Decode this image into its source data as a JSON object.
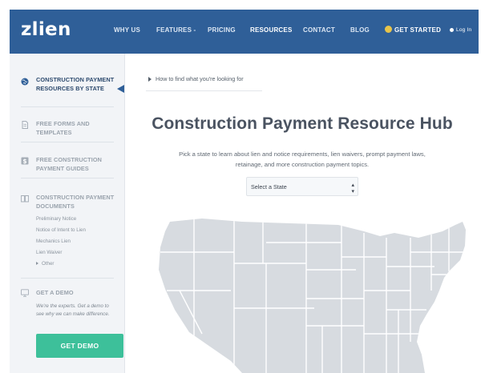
{
  "header": {
    "logo": "zlien",
    "nav": [
      {
        "label": "WHY US"
      },
      {
        "label": "FEATURES -"
      },
      {
        "label": "PRICING"
      },
      {
        "label": "RESOURCES"
      },
      {
        "label": "CONTACT"
      },
      {
        "label": "BLOG"
      },
      {
        "label": "GET STARTED"
      },
      {
        "label": "Log In"
      }
    ]
  },
  "sidebar": {
    "sections": [
      {
        "title": "CONSTRUCTION PAYMENT RESOURCES BY STATE"
      },
      {
        "title": "FREE FORMS AND TEMPLATES"
      },
      {
        "title": "FREE CONSTRUCTION PAYMENT GUIDES"
      },
      {
        "title": "CONSTRUCTION PAYMENT DOCUMENTS"
      },
      {
        "title": "GET A DEMO"
      }
    ],
    "documents": [
      "Preliminary Notice",
      "Notice of Intent to Lien",
      "Mechanics Lien",
      "Lien Waiver",
      "Other"
    ],
    "demo_text": "We're the experts. Get a demo to see why we can make difference.",
    "demo_button": "GET DEMO"
  },
  "main": {
    "breadcrumb": "How to find what you're looking for",
    "title": "Construction Payment Resource Hub",
    "description": "Pick a state to learn about lien and notice requirements, lien waivers, prompt payment laws, retainage, and more construction payment topics.",
    "state_select": {
      "selected": "Select a State"
    }
  },
  "colors": {
    "nav_bg": "#2f5f98",
    "sidebar_bg": "#f2f4f7",
    "accent": "#3dc09a",
    "map_fill": "#d7dbe0",
    "map_border": "#ffffff"
  }
}
